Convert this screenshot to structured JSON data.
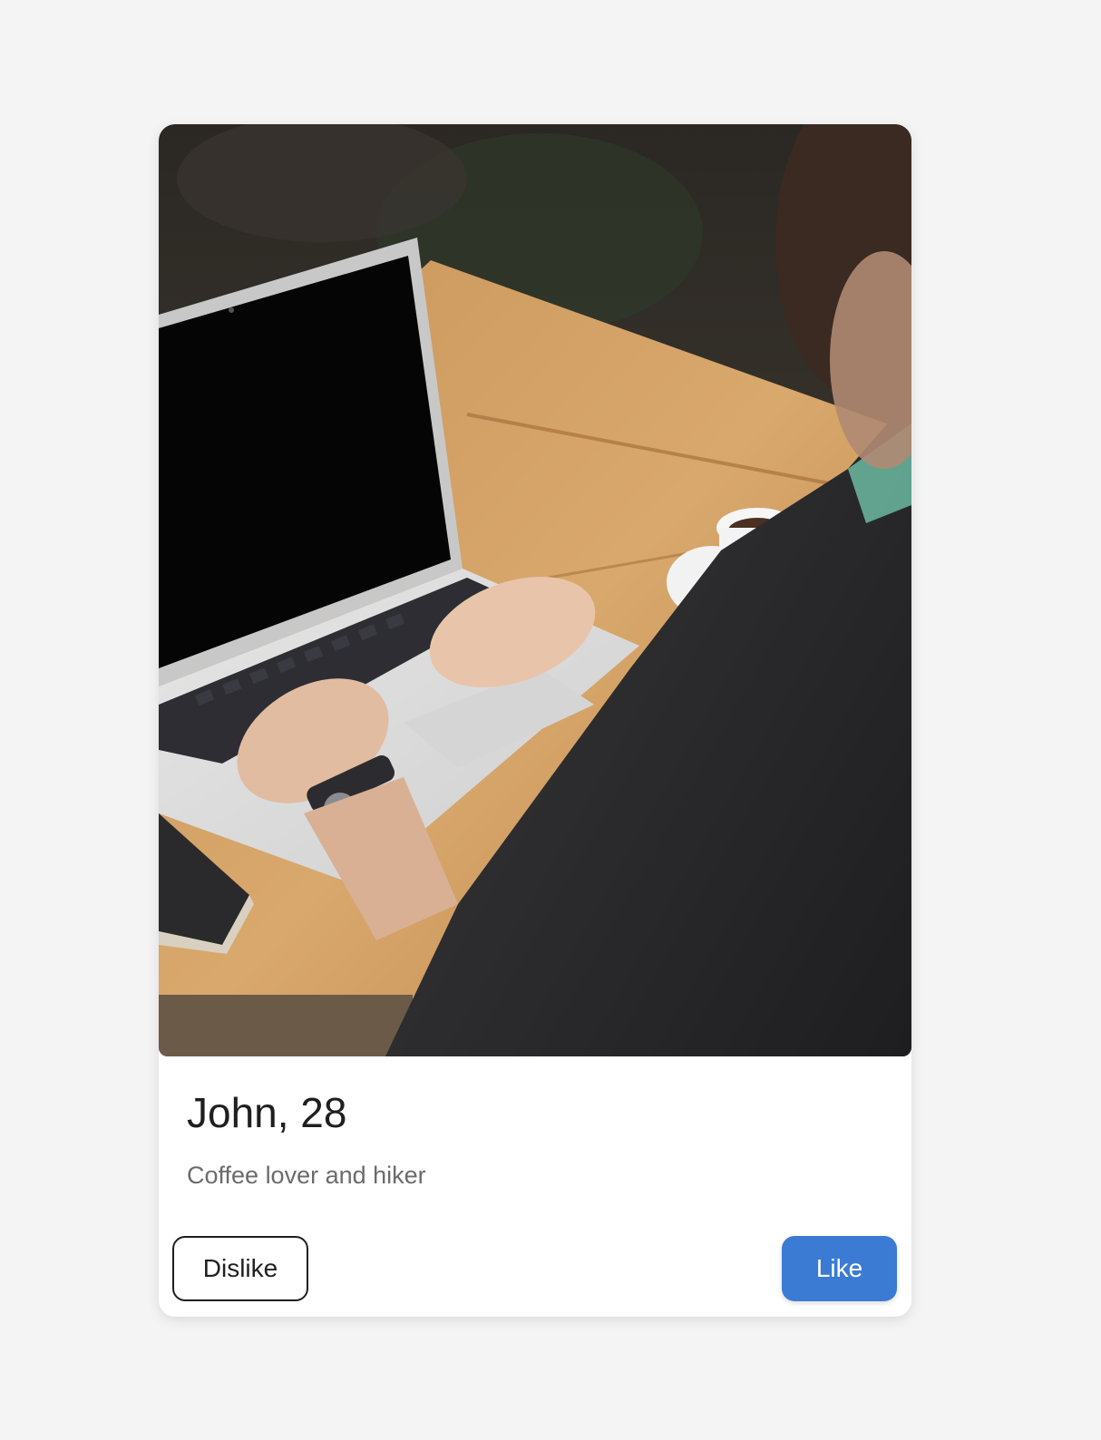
{
  "profile": {
    "name_age": "John, 28",
    "bio": "Coffee lover and hiker"
  },
  "actions": {
    "dislike_label": "Dislike",
    "like_label": "Like"
  },
  "colors": {
    "background": "#f4f4f4",
    "card": "#ffffff",
    "like_button": "#3b7bd4"
  }
}
